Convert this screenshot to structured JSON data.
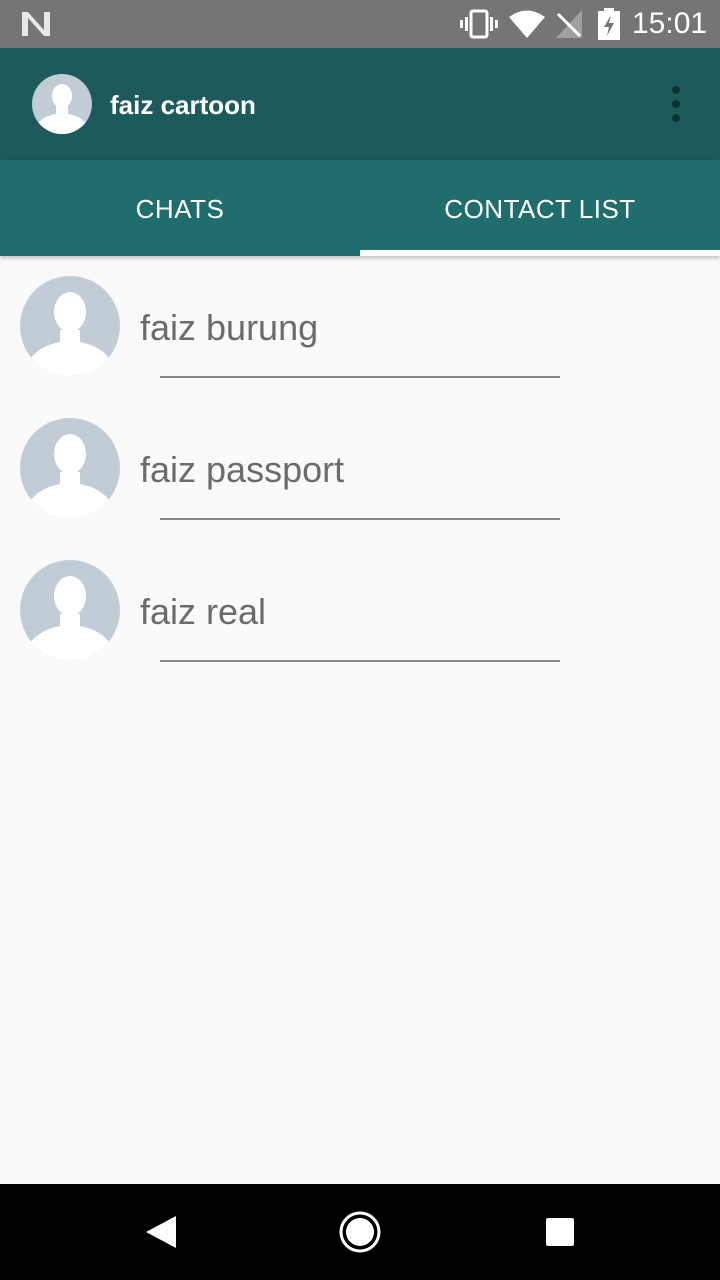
{
  "status_bar": {
    "time": "15:01",
    "icons": [
      "n-logo-icon",
      "vibrate-icon",
      "wifi-icon",
      "no-signal-icon",
      "battery-charging-icon"
    ]
  },
  "app_bar": {
    "title": "faiz cartoon",
    "avatar_icon": "person-avatar-icon",
    "menu_icon": "more-vert-icon"
  },
  "tabs": [
    {
      "label": "CHATS",
      "selected": false
    },
    {
      "label": "CONTACT LIST",
      "selected": true
    }
  ],
  "contacts": [
    {
      "name": "faiz burung"
    },
    {
      "name": "faiz passport"
    },
    {
      "name": "faiz real"
    }
  ],
  "nav_bar": {
    "icons": [
      "back-icon",
      "home-icon",
      "recents-icon"
    ]
  },
  "colors": {
    "app_bar": "#1c5a5b",
    "tabs": "#206d6e",
    "status_bar": "#757575",
    "background": "#fafafa",
    "avatar_bg": "#c1ccd6"
  }
}
